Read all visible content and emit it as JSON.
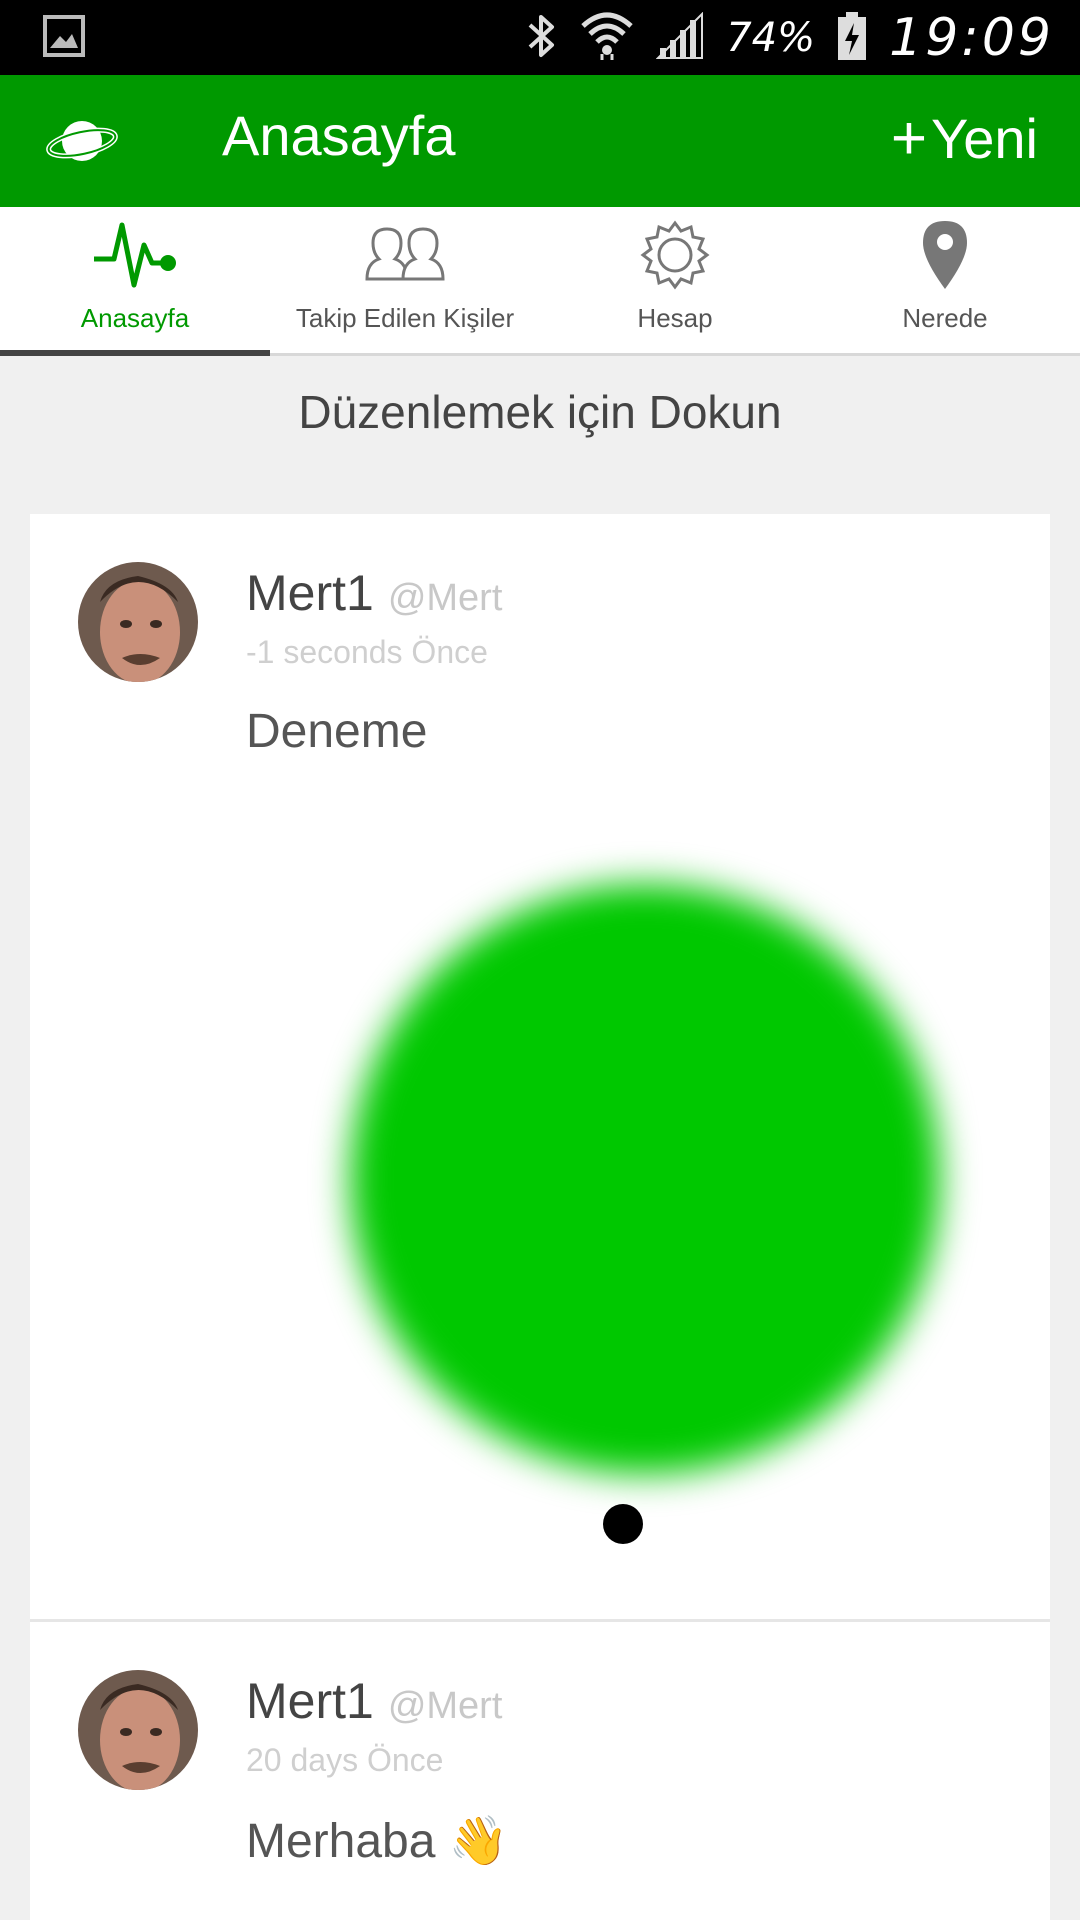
{
  "status_bar": {
    "battery_percent": "74%",
    "time": "19:09",
    "icons": [
      "gallery-notification-icon",
      "bluetooth-icon",
      "wifi-icon",
      "signal-icon",
      "battery-charging-icon"
    ]
  },
  "app_bar": {
    "title": "Anasayfa",
    "new_label": "Yeni",
    "new_prefix": "+",
    "background": "#009900"
  },
  "tabs": [
    {
      "label": "Anasayfa",
      "icon": "pulse-icon",
      "active": true
    },
    {
      "label": "Takip Edilen Kişiler",
      "icon": "people-icon",
      "active": false
    },
    {
      "label": "Hesap",
      "icon": "gear-icon",
      "active": false
    },
    {
      "label": "Nerede",
      "icon": "location-pin-icon",
      "active": false
    }
  ],
  "hint": "Düzenlemek için Dokun",
  "posts": [
    {
      "name": "Mert1",
      "handle": "@Mert",
      "time": "-1 seconds Önce",
      "text": "Deneme",
      "has_image": true
    },
    {
      "name": "Mert1",
      "handle": "@Mert",
      "time": "20 days Önce",
      "text": "Merhaba 👋",
      "has_image": false
    }
  ],
  "colors": {
    "accent": "#009900",
    "image_blob": "#00c800"
  }
}
